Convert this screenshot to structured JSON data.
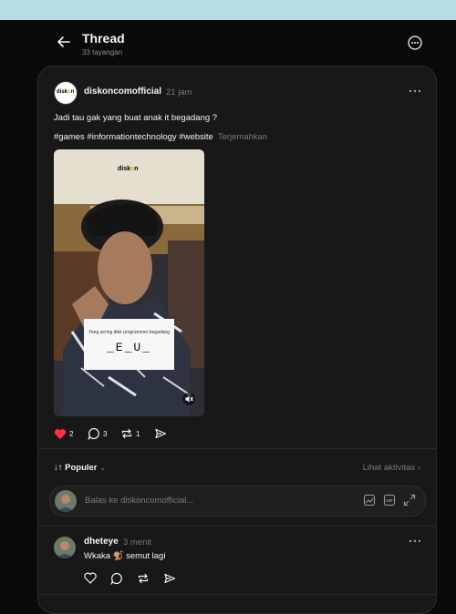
{
  "header": {
    "title": "Thread",
    "views": "33 tayangan"
  },
  "post": {
    "username": "diskoncomofficial",
    "time": "21 jam",
    "text": "Jadi tau gak yang buat anak it begadang ?",
    "hashtags": "#games #informationtechnology #website",
    "translate_label": "Terjemahkan",
    "avatar_logo": {
      "pre": "disk",
      "mid": "o",
      "post": "n"
    },
    "media": {
      "logo": {
        "pre": "disk",
        "mid": "o",
        "post": "n"
      },
      "caption_small": "Yang sering dikir programmer begadang",
      "caption_big": "_E_U_"
    },
    "likes": "2",
    "comments": "3",
    "reposts": "1",
    "colors": {
      "liked": "#ff3040"
    }
  },
  "sort": {
    "label": "Populer",
    "activity_label": "Lihat aktivitas"
  },
  "reply": {
    "placeholder": "Balas ke diskoncomofficial..."
  },
  "comment": {
    "username": "dheteye",
    "time": "3 menit",
    "text": "Wkaka 🐒 semut lagi"
  }
}
